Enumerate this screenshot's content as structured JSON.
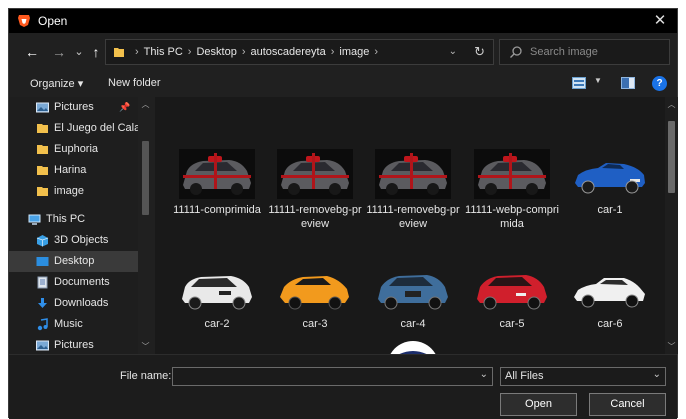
{
  "window": {
    "title": "Open",
    "close_glyph": "✕",
    "accent_color": "#1a73e8"
  },
  "nav": {
    "back_glyph": "←",
    "forward_glyph": "→",
    "recent_glyph": "⌄",
    "up_glyph": "↑"
  },
  "address": {
    "breadcrumb": [
      "This PC",
      "Desktop",
      "autoscadereyta",
      "image"
    ],
    "separator": "›",
    "dropdown_glyph": "⌄",
    "refresh_glyph": "↻"
  },
  "search": {
    "placeholder": "Search image"
  },
  "toolbar": {
    "organize_label": "Organize ▾",
    "new_folder_label": "New folder",
    "help_glyph": "?"
  },
  "sidebar": {
    "items": [
      {
        "label": "Pictures",
        "icon": "pictures-icon",
        "pinned": true
      },
      {
        "label": "El Juego del Cala",
        "icon": "folder-icon"
      },
      {
        "label": "Euphoria",
        "icon": "folder-icon"
      },
      {
        "label": "Harina",
        "icon": "folder-icon"
      },
      {
        "label": "image",
        "icon": "folder-icon"
      },
      {
        "label": "This PC",
        "icon": "this-pc-icon"
      },
      {
        "label": "3D Objects",
        "icon": "3d-objects-icon"
      },
      {
        "label": "Desktop",
        "icon": "desktop-icon",
        "selected": true
      },
      {
        "label": "Documents",
        "icon": "documents-icon"
      },
      {
        "label": "Downloads",
        "icon": "downloads-icon"
      },
      {
        "label": "Music",
        "icon": "music-icon"
      },
      {
        "label": "Pictures",
        "icon": "pictures-icon"
      }
    ]
  },
  "files": [
    {
      "name": "11111-comprimida",
      "image": "grey-suv-with-red-bow"
    },
    {
      "name": "11111-removebg-preview",
      "image": "grey-suv-with-red-bow"
    },
    {
      "name": "11111-removebg-preview",
      "image": "grey-suv-with-red-bow"
    },
    {
      "name": "11111-webp-comprimida",
      "image": "grey-suv-with-red-bow"
    },
    {
      "name": "car-1",
      "image": "blue-convertible"
    },
    {
      "name": "car-2",
      "image": "white-suv"
    },
    {
      "name": "car-3",
      "image": "orange-hatchback"
    },
    {
      "name": "car-4",
      "image": "blue-electric-suv"
    },
    {
      "name": "car-5",
      "image": "red-suv"
    },
    {
      "name": "car-6",
      "image": "white-sedan"
    },
    {
      "name": "",
      "image": "partially-visible-logo"
    }
  ],
  "bottom": {
    "filename_label": "File name:",
    "filename_value": "",
    "filetype_value": "All Files",
    "open_label": "Open",
    "cancel_label": "Cancel"
  }
}
